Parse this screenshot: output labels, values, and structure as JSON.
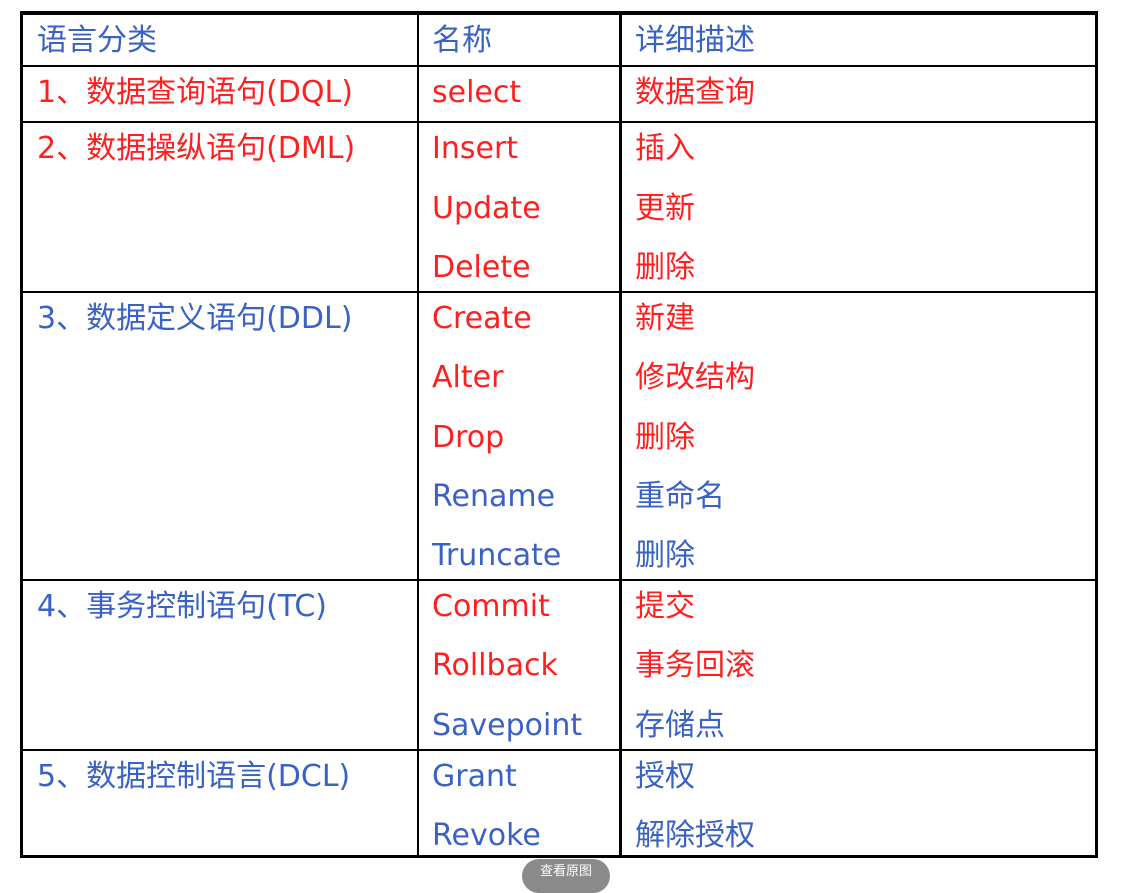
{
  "table": {
    "headers": [
      "语言分类",
      "名称",
      "详细描述"
    ],
    "rows": [
      {
        "category": "1、数据查询语句(DQL)",
        "name": "select",
        "desc": "数据查询",
        "color": "#ff1f1f"
      },
      {
        "category": "2、数据操纵语句(DML)",
        "name": "Insert",
        "desc": "插入",
        "color": "#ff1f1f"
      },
      {
        "category": "",
        "name": "Update",
        "desc": "更新",
        "color": "#ff1f1f"
      },
      {
        "category": "",
        "name": "Delete",
        "desc": "删除",
        "color": "#ff1f1f"
      },
      {
        "category": "3、数据定义语句(DDL)",
        "name": "Create",
        "desc": "新建",
        "color": "#ff1f1f"
      },
      {
        "category": "",
        "name": "Alter",
        "desc": "修改结构",
        "color": "#ff1f1f"
      },
      {
        "category": "",
        "name": "Drop",
        "desc": "删除",
        "color": "#ff1f1f"
      },
      {
        "category": "",
        "name": "Rename",
        "desc": "重命名",
        "color": "#3a62c4"
      },
      {
        "category": "",
        "name": "Truncate",
        "desc": "删除",
        "color": "#3a62c4"
      },
      {
        "category": "4、事务控制语句(TC)",
        "name": "Commit",
        "desc": "提交",
        "color": "#ff1f1f"
      },
      {
        "category": "",
        "name": "Rollback",
        "desc": "事务回滚",
        "color": "#ff1f1f"
      },
      {
        "category": "",
        "name": "Savepoint",
        "desc": "存储点",
        "color": "#3a62c4"
      },
      {
        "category": "5、数据控制语言(DCL)",
        "name": "Grant",
        "desc": "授权",
        "color": "#3a62c4"
      },
      {
        "category": "",
        "name": "Revoke",
        "desc": "解除授权",
        "color": "#3a62c4"
      }
    ]
  },
  "view_original_label": "查看原图"
}
